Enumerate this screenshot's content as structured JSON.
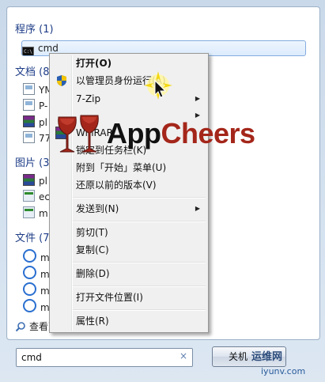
{
  "sections": {
    "programs": {
      "title": "程序 (1)",
      "items": [
        "cmd"
      ]
    },
    "documents": {
      "title": "文档 (8",
      "items": [
        "YM",
        "P-",
        "pl",
        "77"
      ]
    },
    "pictures": {
      "title": "图片 (3",
      "items": [
        "pl",
        "ec",
        "m"
      ]
    },
    "files": {
      "title": "文件 (7",
      "items": [
        "m",
        "m",
        "m",
        "m"
      ]
    }
  },
  "see_more": "查看更",
  "search": {
    "value": "cmd",
    "clear": "×"
  },
  "shutdown": {
    "label": "关机"
  },
  "context_menu": {
    "items": [
      {
        "label": "打开(O)"
      },
      {
        "label": "以管理员身份运行(A)"
      },
      {
        "label": "7-Zip"
      },
      {
        "label": ""
      },
      {
        "label": "WinRAR"
      },
      {
        "label": "锁定到任务栏(K)"
      },
      {
        "label": "附到「开始」菜单(U)"
      },
      {
        "label": "还原以前的版本(V)"
      },
      {
        "label": "发送到(N)"
      },
      {
        "label": "剪切(T)"
      },
      {
        "label": "复制(C)"
      },
      {
        "label": "删除(D)"
      },
      {
        "label": "打开文件位置(I)"
      },
      {
        "label": "属性(R)"
      }
    ]
  },
  "watermark": {
    "brand_part1": "App",
    "brand_part2": "Cheers",
    "site": "运维网",
    "url": "iyunv.com"
  },
  "colors": {
    "section_title": "#1e3d87",
    "brand_red": "#a4261a",
    "selection_border": "#84acdd"
  }
}
